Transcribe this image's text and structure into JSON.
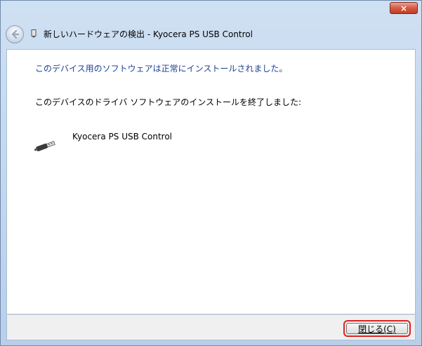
{
  "window": {
    "close_symbol": "×",
    "title": "新しいハードウェアの検出 - Kyocera PS USB Control",
    "back_icon": "back-arrow-icon",
    "device_icon": "device-icon"
  },
  "content": {
    "heading": "このデバイス用のソフトウェアは正常にインストールされました。",
    "description": "このデバイスのドライバ ソフトウェアのインストールを終了しました:",
    "device": {
      "icon": "usb-connector-icon",
      "name": "Kyocera PS USB Control"
    }
  },
  "footer": {
    "close_button_label": "閉じる(C)"
  },
  "colors": {
    "heading": "#1c3f94",
    "highlight_ring": "#dd2222",
    "title_bar": "#cfe0f3"
  }
}
